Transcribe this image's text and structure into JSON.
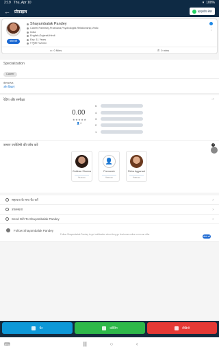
{
  "status": {
    "time": "2:19",
    "date": "Thu, Apr 10",
    "battery": "100%"
  },
  "topbar": {
    "back": "←",
    "title": "प्रोफ़ाइल",
    "whatsapp": "व्हाट्सऐप शेयर"
  },
  "profile": {
    "name": "Shayambalak Pandey",
    "skills": "Career,Palmistry,Prashana,Psychologist,Relationship,Vedic",
    "location": "India",
    "languages": "English,Gujarati,Hindi",
    "experience": "Exp: 11 Years",
    "price": "₹ मुफ्त ₹12/min",
    "call_button": "कॉल करें",
    "chat_mins": "0 Mins",
    "call_mins": "0 mins"
  },
  "specialization": {
    "title": "Specialization",
    "chip": "Career"
  },
  "description": {
    "title": "dsvsdvs",
    "link": "और दिखाएं"
  },
  "ratings": {
    "title": "रेटिंग और समीक्षा",
    "average": "0.00",
    "stars": "★★★★★",
    "count": "0",
    "levels": [
      "5",
      "4",
      "3",
      "2",
      "1"
    ]
  },
  "astrologers": {
    "title": "समान ज्योतिषी की जाँच करें",
    "items": [
      {
        "name": "Gulshan Sharma",
        "price": "₹12/min"
      },
      {
        "name": "Premansh",
        "price": "₹20/min"
      },
      {
        "name": "Richa Aggarwal",
        "price": "₹30/min"
      }
    ]
  },
  "list": {
    "help": "सहायता के साथ चैट करें",
    "support": "उपलब्धता",
    "gift": "Send Gift To Shayambalak Pandey",
    "follow": "Follow Shayambalak Pandey",
    "follow_sub": "Follow Shayambalak Pandey to get notification when they go live/come online or run an offer",
    "follow_btn": "फॉलो करें"
  },
  "actions": {
    "chat": "चैट",
    "call": "कॉलिंग",
    "video": "वीडियो"
  },
  "colors": {
    "primary": "#0e2a44",
    "chat": "#0d98d8",
    "call": "#2eb84a",
    "video": "#e53935"
  }
}
